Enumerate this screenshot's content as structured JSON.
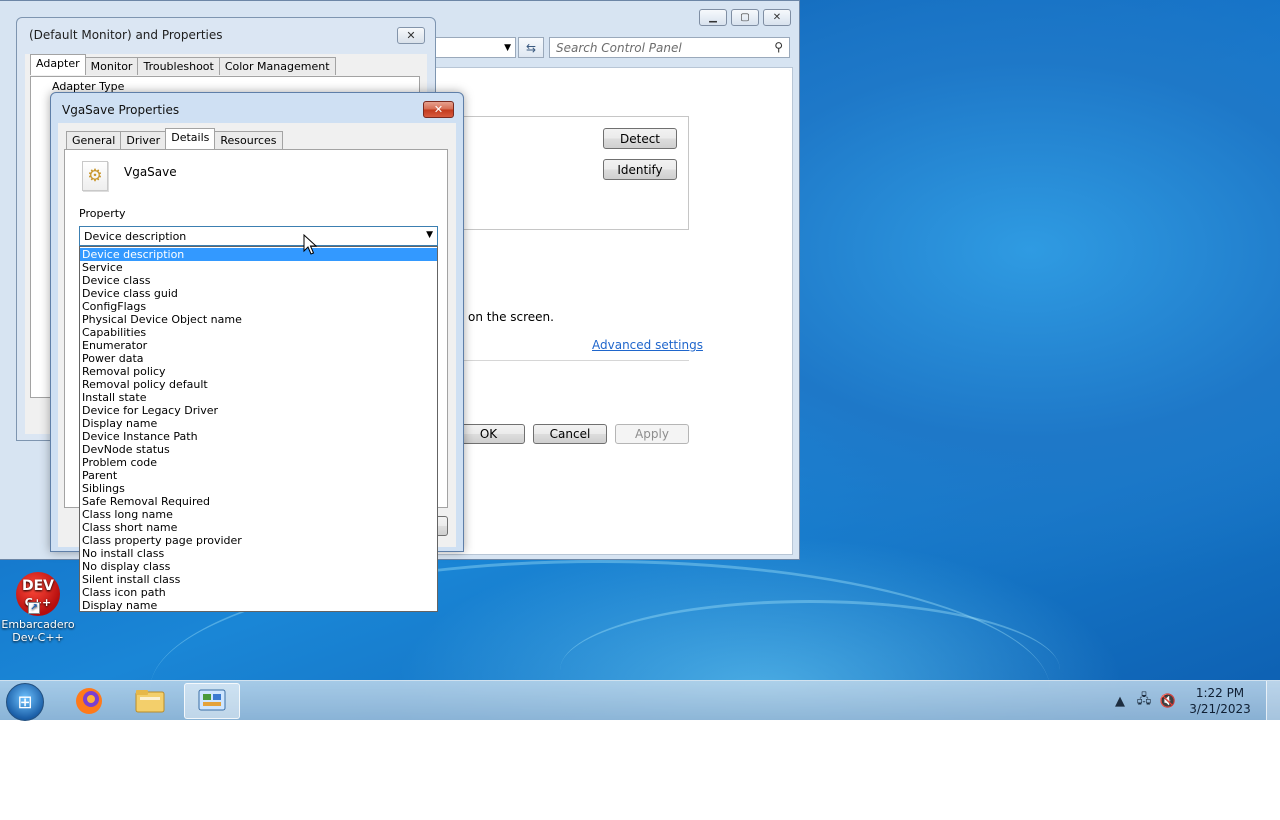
{
  "control_panel": {
    "search_placeholder": "Search Control Panel",
    "detect_label": "Detect",
    "identify_label": "Identify",
    "screen_text": "on the screen.",
    "advanced_link": "Advanced settings",
    "ok_label": "OK",
    "cancel_label": "Cancel",
    "apply_label": "Apply"
  },
  "monitor_dialog": {
    "title": "(Default Monitor) and  Properties",
    "tabs": [
      "Adapter",
      "Monitor",
      "Troubleshoot",
      "Color Management"
    ],
    "group_label": "Adapter Type"
  },
  "vga_dialog": {
    "title": "VgaSave Properties",
    "tabs": [
      "General",
      "Driver",
      "Details",
      "Resources"
    ],
    "device_name": "VgaSave",
    "property_label": "Property",
    "selected_property": "Device description",
    "options": [
      "Device description",
      "Service",
      "Device class",
      "Device class guid",
      "ConfigFlags",
      "Physical Device Object name",
      "Capabilities",
      "Enumerator",
      "Power data",
      "Removal policy",
      "Removal policy default",
      "Install state",
      "Device for Legacy Driver",
      "Display name",
      "Device Instance Path",
      "DevNode status",
      "Problem code",
      "Parent",
      "Siblings",
      "Safe Removal Required",
      "Class long name",
      "Class short name",
      "Class property page provider",
      "No install class",
      "No display class",
      "Silent install class",
      "Class icon path",
      "Display name"
    ]
  },
  "desktop": {
    "icon_label_line1": "Embarcadero",
    "icon_label_line2": "Dev-C++",
    "icon_logo_text": "DEV",
    "icon_logo_sub": "C++"
  },
  "taskbar": {
    "time": "1:22 PM",
    "date": "3/21/2023"
  },
  "colors": {
    "selection": "#3399ff",
    "link": "#1f66cc",
    "desktop": "#1373c9"
  }
}
